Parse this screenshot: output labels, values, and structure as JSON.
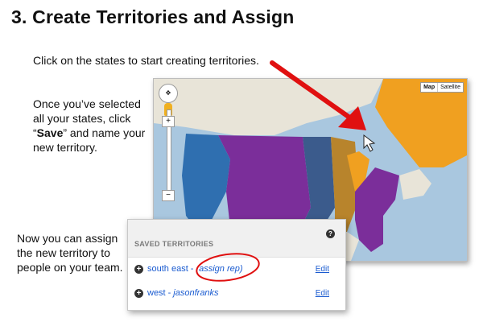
{
  "heading": "3. Create Territories and Assign",
  "intro": "Click on the states to start creating territories.",
  "instructions": {
    "line_before_bold": "Once you’ve selected all your states, click “",
    "bold_word": "Save",
    "line_after_bold": "” and name your new territory."
  },
  "assign_text": "Now you can assign the new territory to people on your team.",
  "map": {
    "map_type_buttons": [
      "Map",
      "Satellite"
    ],
    "zoom_in": "+",
    "zoom_out": "−",
    "colors": {
      "water": "#a9c7df",
      "land": "#e8e4d8",
      "blue": "#2f6fb0",
      "steel": "#3b5b8c",
      "purple": "#7b2e9a",
      "orange": "#f0a020",
      "brown": "#b8842c",
      "arrow": "#e01010"
    }
  },
  "saved_panel": {
    "title": "SAVED TERRITORIES",
    "help": "?",
    "rows": [
      {
        "name": "south east",
        "separator": "-",
        "assignee": "(assign rep)",
        "edit": "Edit"
      },
      {
        "name": "west",
        "separator": "-",
        "assignee": "jasonfranks",
        "edit": "Edit"
      }
    ]
  }
}
